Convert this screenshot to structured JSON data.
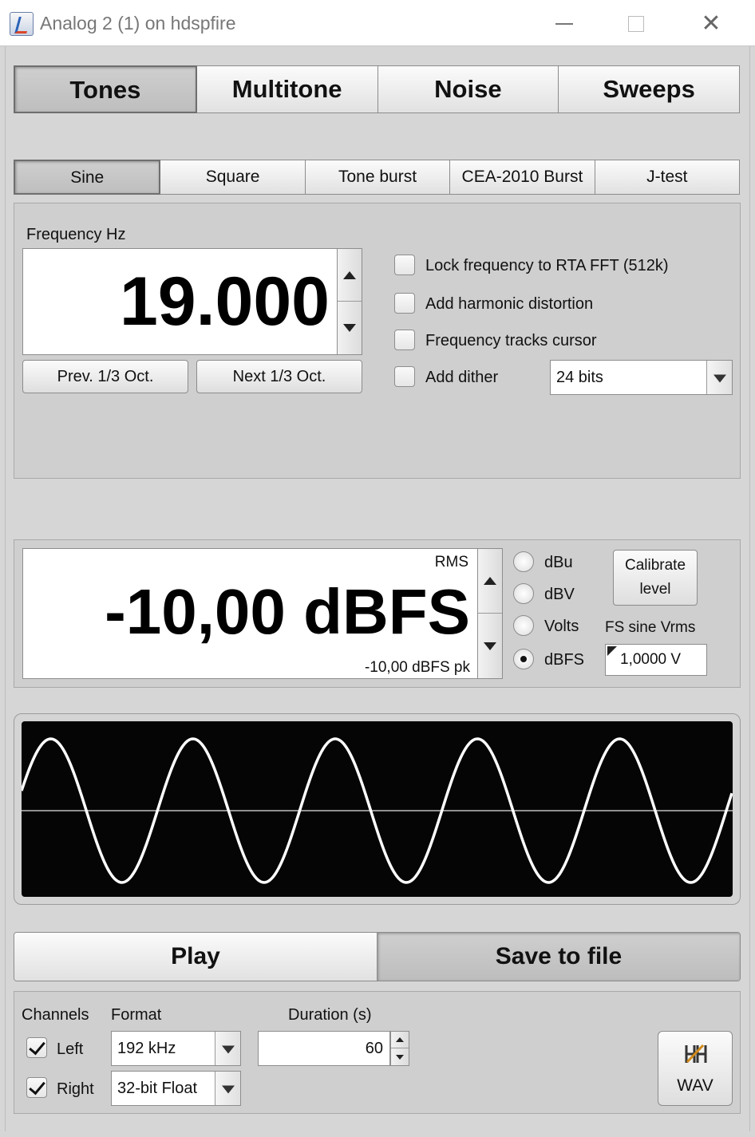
{
  "window": {
    "title": "Analog 2 (1) on hdspfire"
  },
  "main_tabs": [
    "Tones",
    "Multitone",
    "Noise",
    "Sweeps"
  ],
  "sub_tabs": [
    "Sine",
    "Square",
    "Tone burst",
    "CEA-2010 Burst",
    "J-test"
  ],
  "frequency": {
    "label": "Frequency Hz",
    "value": "19.000",
    "prev_button": "Prev. 1/3 Oct.",
    "next_button": "Next 1/3 Oct."
  },
  "options": {
    "lock_fft": {
      "label": "Lock frequency to RTA FFT (512k)",
      "checked": false
    },
    "harmonic": {
      "label": "Add harmonic distortion",
      "checked": false
    },
    "tracks_cursor": {
      "label": "Frequency tracks cursor",
      "checked": false
    },
    "dither": {
      "label": "Add dither",
      "checked": false
    },
    "dither_bits": "24 bits"
  },
  "level": {
    "mode": "RMS",
    "value": "-10,00 dBFS",
    "peak": "-10,00 dBFS pk",
    "units": [
      "dBu",
      "dBV",
      "Volts",
      "dBFS"
    ],
    "selected_unit": "dBFS",
    "calibrate_line1": "Calibrate",
    "calibrate_line2": "level",
    "fs_label": "FS sine Vrms",
    "fs_value": "1,0000 V"
  },
  "scope": {
    "cycles": 5,
    "trace_color": "#ffffff",
    "background": "#050505"
  },
  "actions": {
    "play": "Play",
    "save": "Save to file"
  },
  "file": {
    "channels_label": "Channels",
    "left": {
      "label": "Left",
      "checked": true
    },
    "right": {
      "label": "Right",
      "checked": true
    },
    "format_label": "Format",
    "sample_rate": "192 kHz",
    "bit_depth": "32-bit Float",
    "duration_label": "Duration (s)",
    "duration": "60",
    "wav_label": "WAV"
  }
}
